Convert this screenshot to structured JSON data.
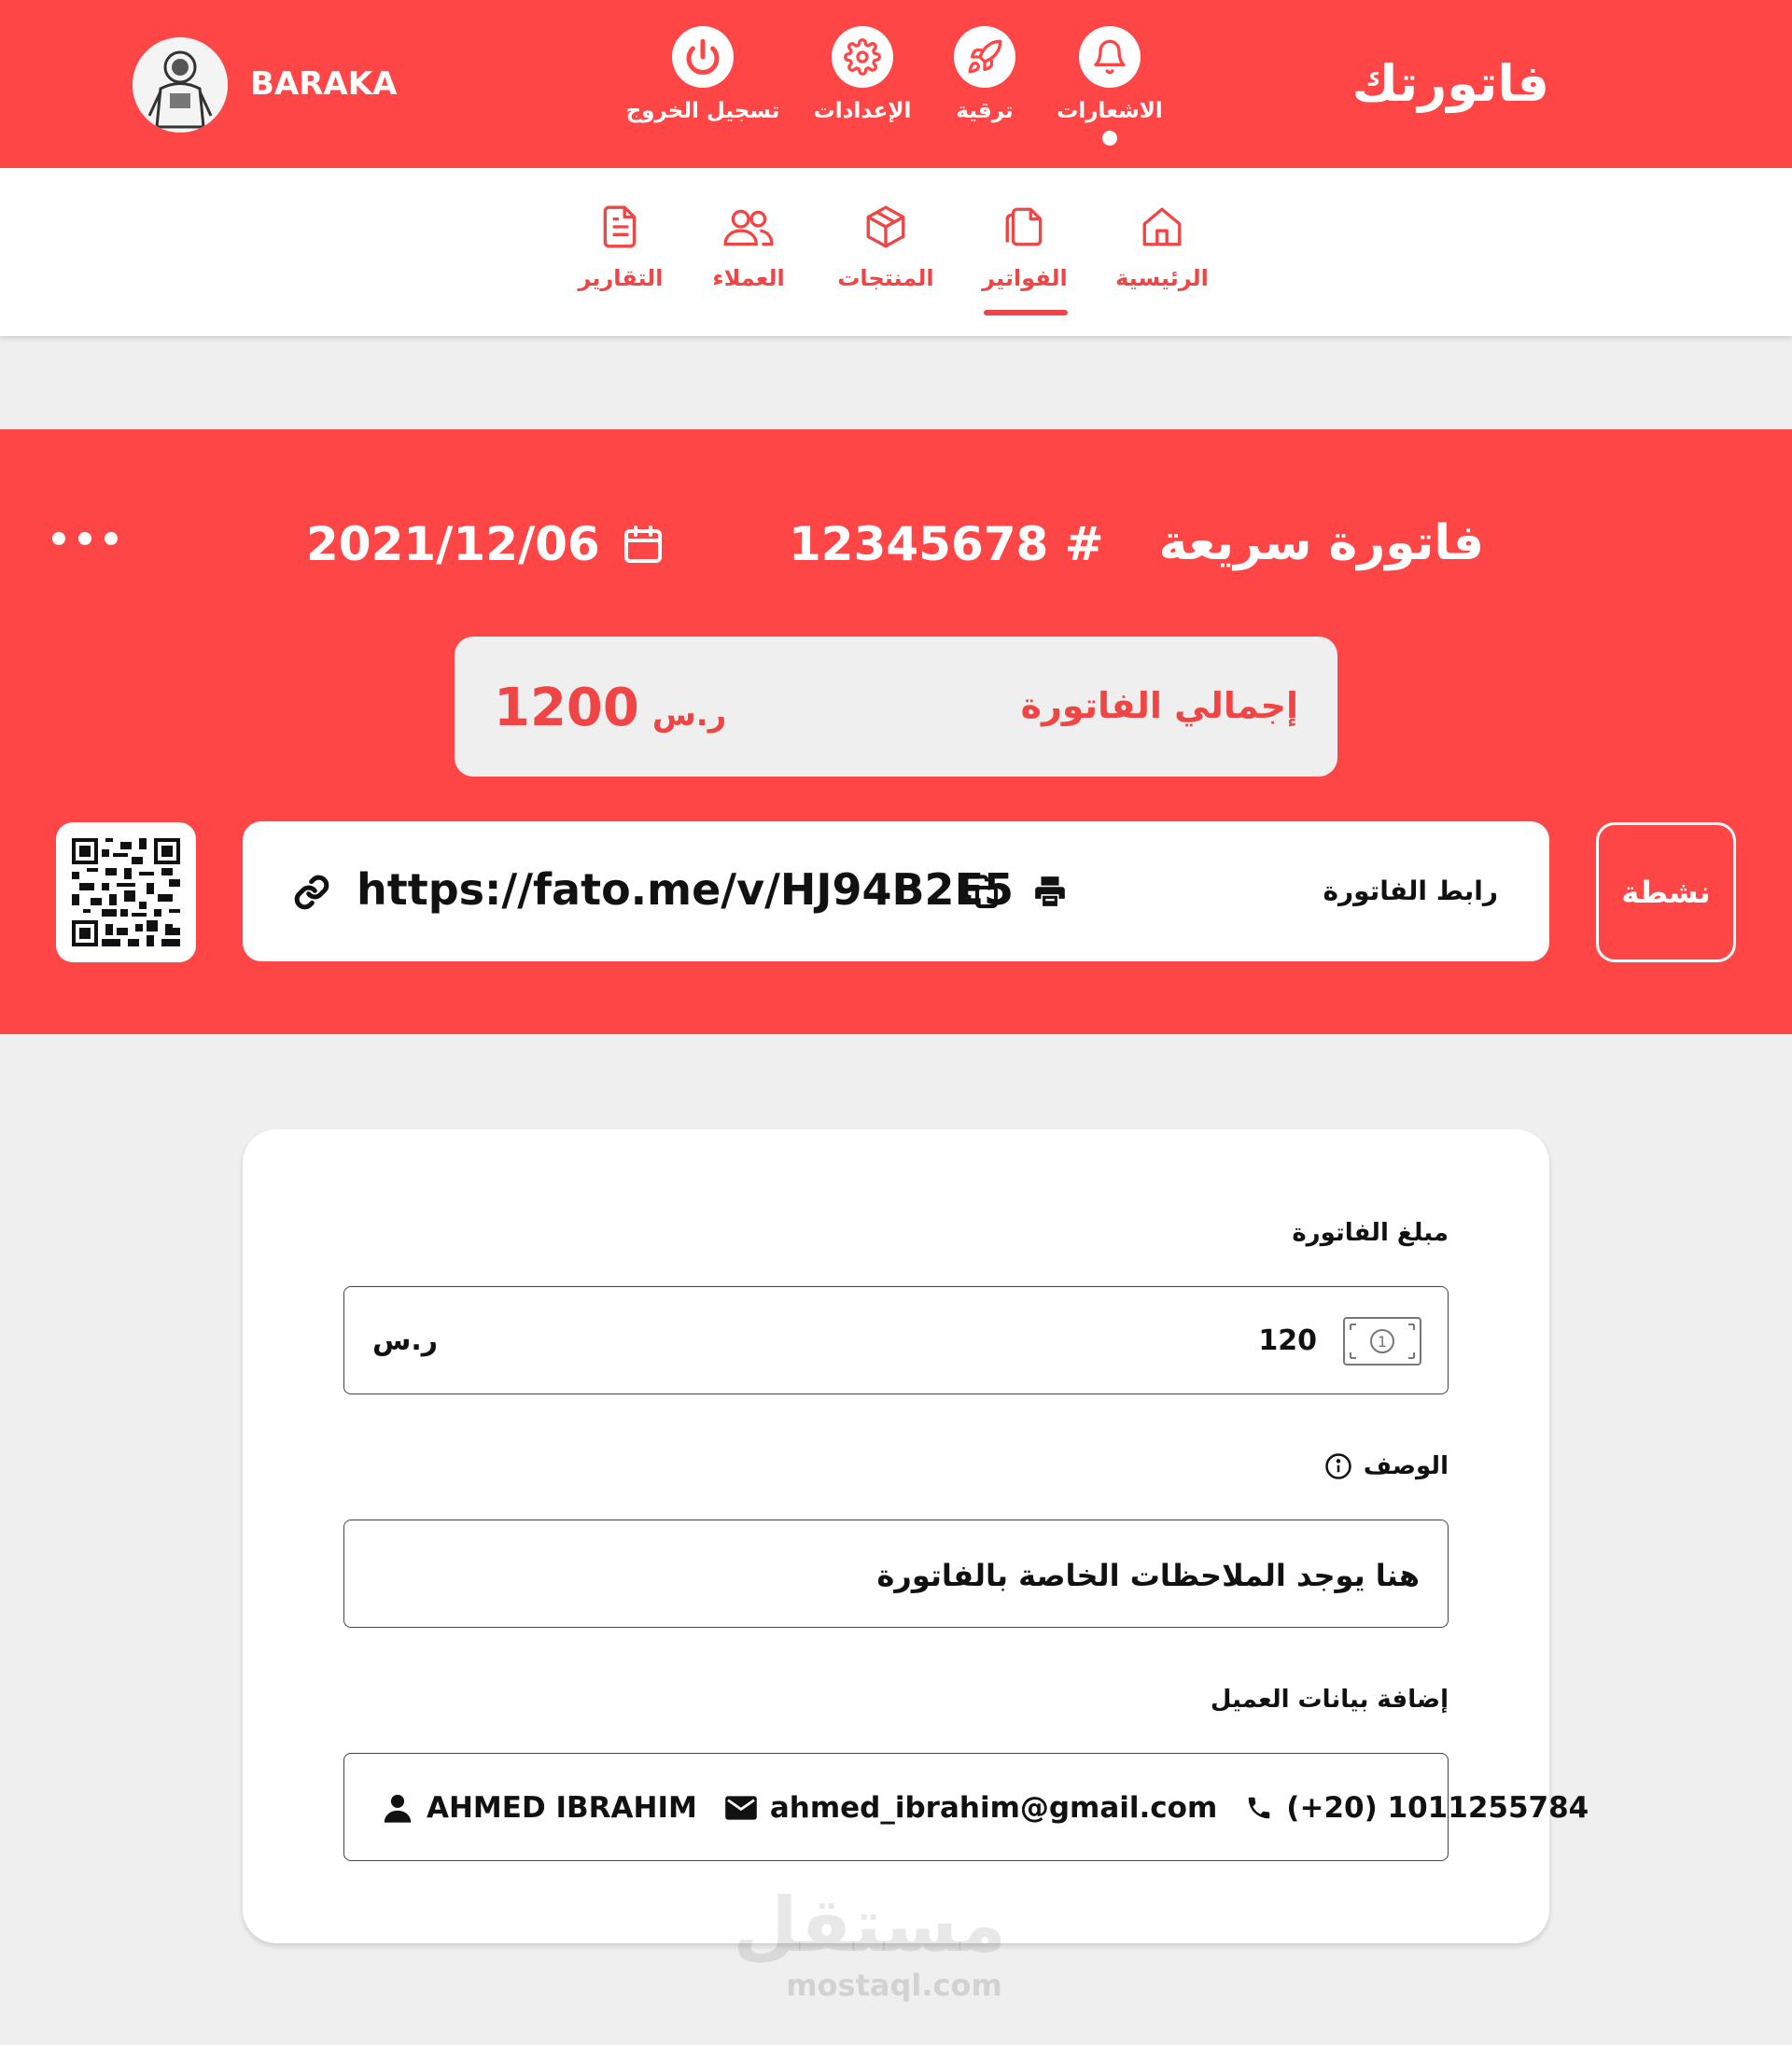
{
  "app": {
    "brand": "فاتورتك"
  },
  "topnav": {
    "notifications": "الاشعارات",
    "upgrade": "ترقية",
    "settings": "الإعدادات",
    "logout": "تسجيل الخروج",
    "user_name": "BARAKA"
  },
  "tabs": [
    {
      "label": "الرئيسية",
      "icon": "home-icon",
      "active": false
    },
    {
      "label": "الفواتير",
      "icon": "documents-icon",
      "active": true
    },
    {
      "label": "المنتجات",
      "icon": "box-icon",
      "active": false
    },
    {
      "label": "العملاء",
      "icon": "users-icon",
      "active": false
    },
    {
      "label": "التقارير",
      "icon": "report-icon",
      "active": false
    }
  ],
  "invoice": {
    "title": "فاتورة سريعة",
    "number": "12345678 #",
    "date": "2021/12/06",
    "total_label": "إجمالي الفاتورة",
    "total_value": "1200",
    "total_currency": "ر.س",
    "link_label": "رابط الفاتورة",
    "link_url": "https://fato.me/v/HJ94B2E5",
    "status": "نشطة"
  },
  "form": {
    "amount_label": "مبلغ الفاتورة",
    "amount_value": "120",
    "amount_currency": "ر.س",
    "description_label": "الوصف",
    "description_value": "هنا يوجد الملاحظات الخاصة بالفاتورة",
    "client_label": "إضافة بيانات العميل",
    "client_name": "AHMED IBRAHIM",
    "client_email": "ahmed_ibrahim@gmail.com",
    "client_phone": "(+20) 1011255784"
  },
  "watermark": {
    "ar": "مستقل",
    "en": "mostaql.com"
  },
  "colors": {
    "primary": "#ff4646",
    "accent_text": "#f04545",
    "background": "#efefef"
  }
}
